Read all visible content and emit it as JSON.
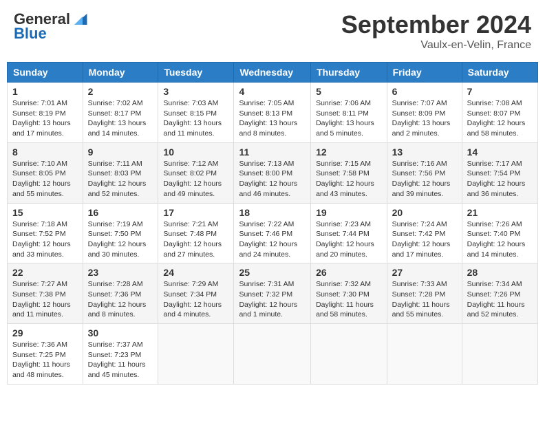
{
  "header": {
    "logo_general": "General",
    "logo_blue": "Blue",
    "month_year": "September 2024",
    "location": "Vaulx-en-Velin, France"
  },
  "weekdays": [
    "Sunday",
    "Monday",
    "Tuesday",
    "Wednesday",
    "Thursday",
    "Friday",
    "Saturday"
  ],
  "weeks": [
    [
      {
        "day": "1",
        "info": "Sunrise: 7:01 AM\nSunset: 8:19 PM\nDaylight: 13 hours and 17 minutes."
      },
      {
        "day": "2",
        "info": "Sunrise: 7:02 AM\nSunset: 8:17 PM\nDaylight: 13 hours and 14 minutes."
      },
      {
        "day": "3",
        "info": "Sunrise: 7:03 AM\nSunset: 8:15 PM\nDaylight: 13 hours and 11 minutes."
      },
      {
        "day": "4",
        "info": "Sunrise: 7:05 AM\nSunset: 8:13 PM\nDaylight: 13 hours and 8 minutes."
      },
      {
        "day": "5",
        "info": "Sunrise: 7:06 AM\nSunset: 8:11 PM\nDaylight: 13 hours and 5 minutes."
      },
      {
        "day": "6",
        "info": "Sunrise: 7:07 AM\nSunset: 8:09 PM\nDaylight: 13 hours and 2 minutes."
      },
      {
        "day": "7",
        "info": "Sunrise: 7:08 AM\nSunset: 8:07 PM\nDaylight: 12 hours and 58 minutes."
      }
    ],
    [
      {
        "day": "8",
        "info": "Sunrise: 7:10 AM\nSunset: 8:05 PM\nDaylight: 12 hours and 55 minutes."
      },
      {
        "day": "9",
        "info": "Sunrise: 7:11 AM\nSunset: 8:03 PM\nDaylight: 12 hours and 52 minutes."
      },
      {
        "day": "10",
        "info": "Sunrise: 7:12 AM\nSunset: 8:02 PM\nDaylight: 12 hours and 49 minutes."
      },
      {
        "day": "11",
        "info": "Sunrise: 7:13 AM\nSunset: 8:00 PM\nDaylight: 12 hours and 46 minutes."
      },
      {
        "day": "12",
        "info": "Sunrise: 7:15 AM\nSunset: 7:58 PM\nDaylight: 12 hours and 43 minutes."
      },
      {
        "day": "13",
        "info": "Sunrise: 7:16 AM\nSunset: 7:56 PM\nDaylight: 12 hours and 39 minutes."
      },
      {
        "day": "14",
        "info": "Sunrise: 7:17 AM\nSunset: 7:54 PM\nDaylight: 12 hours and 36 minutes."
      }
    ],
    [
      {
        "day": "15",
        "info": "Sunrise: 7:18 AM\nSunset: 7:52 PM\nDaylight: 12 hours and 33 minutes."
      },
      {
        "day": "16",
        "info": "Sunrise: 7:19 AM\nSunset: 7:50 PM\nDaylight: 12 hours and 30 minutes."
      },
      {
        "day": "17",
        "info": "Sunrise: 7:21 AM\nSunset: 7:48 PM\nDaylight: 12 hours and 27 minutes."
      },
      {
        "day": "18",
        "info": "Sunrise: 7:22 AM\nSunset: 7:46 PM\nDaylight: 12 hours and 24 minutes."
      },
      {
        "day": "19",
        "info": "Sunrise: 7:23 AM\nSunset: 7:44 PM\nDaylight: 12 hours and 20 minutes."
      },
      {
        "day": "20",
        "info": "Sunrise: 7:24 AM\nSunset: 7:42 PM\nDaylight: 12 hours and 17 minutes."
      },
      {
        "day": "21",
        "info": "Sunrise: 7:26 AM\nSunset: 7:40 PM\nDaylight: 12 hours and 14 minutes."
      }
    ],
    [
      {
        "day": "22",
        "info": "Sunrise: 7:27 AM\nSunset: 7:38 PM\nDaylight: 12 hours and 11 minutes."
      },
      {
        "day": "23",
        "info": "Sunrise: 7:28 AM\nSunset: 7:36 PM\nDaylight: 12 hours and 8 minutes."
      },
      {
        "day": "24",
        "info": "Sunrise: 7:29 AM\nSunset: 7:34 PM\nDaylight: 12 hours and 4 minutes."
      },
      {
        "day": "25",
        "info": "Sunrise: 7:31 AM\nSunset: 7:32 PM\nDaylight: 12 hours and 1 minute."
      },
      {
        "day": "26",
        "info": "Sunrise: 7:32 AM\nSunset: 7:30 PM\nDaylight: 11 hours and 58 minutes."
      },
      {
        "day": "27",
        "info": "Sunrise: 7:33 AM\nSunset: 7:28 PM\nDaylight: 11 hours and 55 minutes."
      },
      {
        "day": "28",
        "info": "Sunrise: 7:34 AM\nSunset: 7:26 PM\nDaylight: 11 hours and 52 minutes."
      }
    ],
    [
      {
        "day": "29",
        "info": "Sunrise: 7:36 AM\nSunset: 7:25 PM\nDaylight: 11 hours and 48 minutes."
      },
      {
        "day": "30",
        "info": "Sunrise: 7:37 AM\nSunset: 7:23 PM\nDaylight: 11 hours and 45 minutes."
      },
      null,
      null,
      null,
      null,
      null
    ]
  ]
}
